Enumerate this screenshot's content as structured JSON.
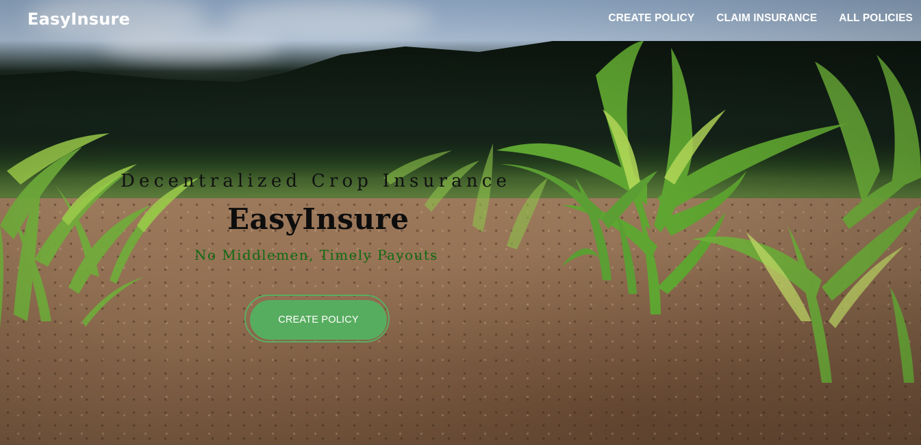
{
  "navbar": {
    "brand": "EasyInsure",
    "links": [
      {
        "label": "CREATE POLICY"
      },
      {
        "label": "CLAIM INSURANCE"
      },
      {
        "label": "ALL POLICIES"
      }
    ]
  },
  "hero": {
    "tagline": "Decentralized Crop Insurance",
    "title": "EasyInsure",
    "subtitle": "No Middlemen, Timely Payouts",
    "cta_label": "CREATE POLICY"
  },
  "colors": {
    "accent": "#57ad5f",
    "subtitle": "#0f6a12",
    "nav_text": "#ffffff"
  }
}
